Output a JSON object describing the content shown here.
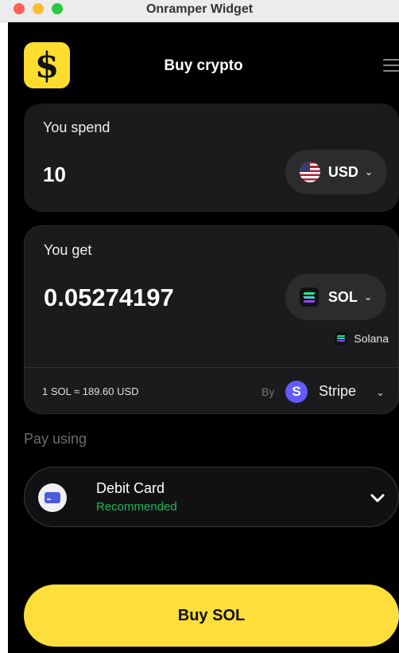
{
  "window": {
    "title": "Onramper Widget"
  },
  "header": {
    "logo_glyph": "$",
    "title": "Buy crypto"
  },
  "spend": {
    "label": "You spend",
    "amount": "10",
    "currency": "USD"
  },
  "get": {
    "label": "You get",
    "amount": "0.05274197",
    "currency": "SOL",
    "network": "Solana",
    "rate": "1 SOL ≈ 189.60 USD",
    "by_label": "By",
    "provider_initial": "S",
    "provider": "Stripe"
  },
  "pay": {
    "label": "Pay using",
    "method": "Debit Card",
    "badge": "Recommended"
  },
  "cta": {
    "label": "Buy SOL"
  },
  "colors": {
    "accent": "#fede3a",
    "background": "#000000",
    "card": "#1b1b1d",
    "recommended": "#1fb954",
    "stripe": "#635bff"
  },
  "icons": [
    "dollar-logo-icon",
    "menu-icon",
    "us-flag-icon",
    "chevron-down-icon",
    "solana-icon",
    "stripe-icon",
    "debit-card-icon"
  ]
}
